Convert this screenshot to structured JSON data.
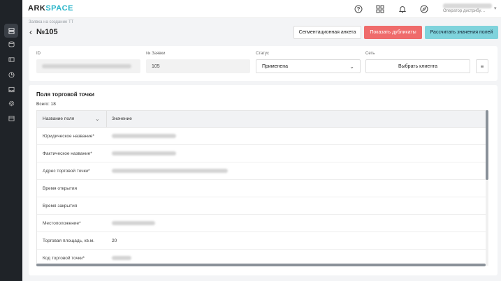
{
  "app": {
    "logo_main": "ARK",
    "logo_accent": "SPACE"
  },
  "topbar": {
    "icons": [
      "support-icon",
      "apps-grid-icon",
      "bell-icon",
      "compass-icon"
    ],
    "user_role": "Оператор дистрибу…"
  },
  "sidebar": {
    "icons": [
      "requests-icon",
      "database-icon",
      "cards-icon",
      "analytics-icon",
      "inbox-icon",
      "settings-icon",
      "calendar-icon"
    ],
    "active_index": 0
  },
  "breadcrumb": "Заявка на создание ТТ",
  "page": {
    "title": "№105"
  },
  "actions": {
    "segment_label": "Сегментационная анкета",
    "duplicates_label": "Показать дубликаты",
    "calculate_label": "Рассчитать значения полей"
  },
  "form": {
    "id_label": "ID",
    "request_no_label": "№ Заявки",
    "request_no_value": "105",
    "status_label": "Статус",
    "status_value": "Применена",
    "network_label": "Сеть",
    "choose_client_label": "Выбрать клиента",
    "extra_button": "≡"
  },
  "table": {
    "heading": "Поля торговой точки",
    "total": "Всего: 18",
    "col_name": "Название поля",
    "col_value": "Значение",
    "rows": [
      {
        "name": "Юридическое название*",
        "value": ""
      },
      {
        "name": "Фактическое название*",
        "value": ""
      },
      {
        "name": "Адрес торговой точки*",
        "value": ""
      },
      {
        "name": "Время открытия",
        "value": ""
      },
      {
        "name": "Время закрытия",
        "value": ""
      },
      {
        "name": "Местоположение*",
        "value": ""
      },
      {
        "name": "Торговая площадь, кв.м.",
        "value": "20"
      },
      {
        "name": "Код торговой точки*",
        "value": ""
      }
    ]
  },
  "colors": {
    "accent": "#2bb5c9",
    "danger": "#ef6b6b",
    "teal_button": "#7fd3dc",
    "rail": "#1f2328"
  }
}
